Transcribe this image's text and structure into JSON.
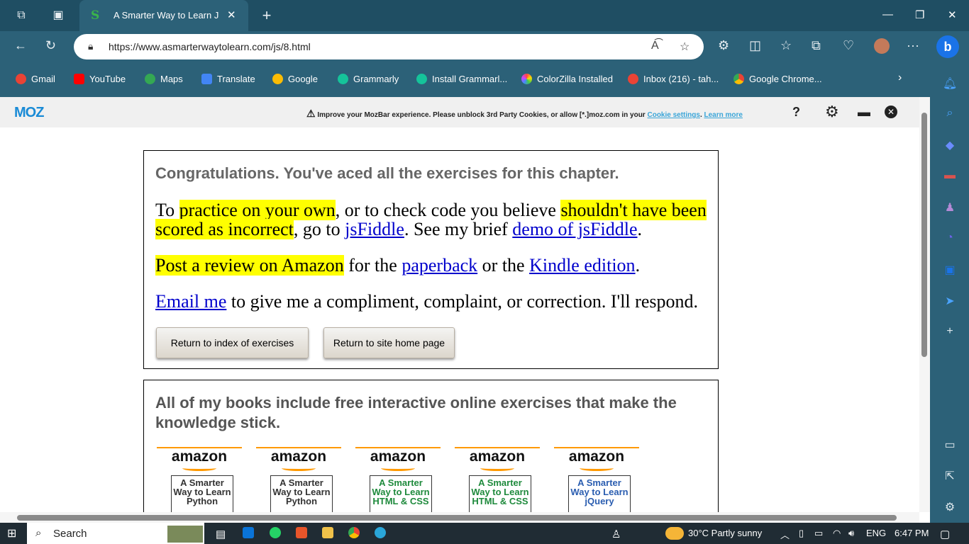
{
  "browser": {
    "tab_title": "A Smarter Way to Learn Jav",
    "url": "https://www.asmarterwaytolearn.com/js/8.html"
  },
  "bookmarks": [
    {
      "label": "Gmail",
      "color": "#ea4335"
    },
    {
      "label": "YouTube",
      "color": "#ff0000"
    },
    {
      "label": "Maps",
      "color": "#34a853"
    },
    {
      "label": "Translate",
      "color": "#4285f4"
    },
    {
      "label": "Google",
      "color": "#fbbc05"
    },
    {
      "label": "Grammarly",
      "color": "#15c39a"
    },
    {
      "label": "Install Grammarl...",
      "color": "#15c39a"
    },
    {
      "label": "ColorZilla Installed",
      "color": "#c04cf0"
    },
    {
      "label": "Inbox (216) - tah...",
      "color": "#ea4335"
    },
    {
      "label": "Google Chrome...",
      "color": "#fbbc05"
    }
  ],
  "mozbar": {
    "logo": "MOZ",
    "message": "Improve your MozBar experience. Please unblock 3rd Party Cookies, or allow [*.]moz.com in your",
    "cookie_link": "Cookie settings",
    "learn_more": "Learn more"
  },
  "content": {
    "congrats": "Congratulations. You've aced all the exercises for this chapter.",
    "p1_prefix": "To ",
    "p1_hl1": "practice on your own",
    "p1_mid": ", or to check code you believe ",
    "p1_hl2": "shouldn't have been scored as incorrect",
    "p1_mid2": ", go to ",
    "p1_link1": "jsFiddle",
    "p1_mid3": ". See my brief ",
    "p1_link2": "demo of jsFiddle",
    "p1_end": ".",
    "p2_hl": "Post a review on Amazon",
    "p2_mid": " for the ",
    "p2_link1": "paperback",
    "p2_mid2": " or the ",
    "p2_link2": "Kindle edition",
    "p2_end": ".",
    "p3_link": "Email me",
    "p3_rest": " to give me a compliment, complaint, or correction. I'll respond.",
    "btn_index": "Return to index of exercises",
    "btn_home": "Return to site home page",
    "books_heading": "All of my books include free interactive online exercises that make the knowledge stick.",
    "books": [
      {
        "brand": "amazon",
        "cover": "A Smarter Way to Learn Python",
        "color": "#333333"
      },
      {
        "brand": "amazon",
        "cover": "A Smarter Way to Learn Python",
        "color": "#333333"
      },
      {
        "brand": "amazon",
        "cover": "A Smarter Way to Learn HTML & CSS",
        "color": "#1e8a3c"
      },
      {
        "brand": "amazon",
        "cover": "A Smarter Way to Learn HTML & CSS",
        "color": "#1e8a3c"
      },
      {
        "brand": "amazon",
        "cover": "A Smarter Way to Learn jQuery",
        "color": "#2a5db0"
      }
    ]
  },
  "taskbar": {
    "search": "Search",
    "weather": "30°C  Partly sunny",
    "lang": "ENG",
    "time": "6:47 PM"
  }
}
